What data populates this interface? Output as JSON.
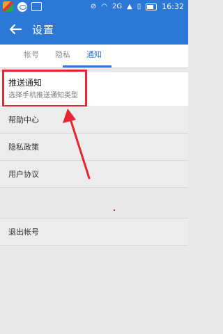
{
  "status": {
    "time": "16:32",
    "network": "2G",
    "icons": [
      "app-launcher-icon",
      "messenger-icon",
      "image-icon",
      "no-signal-icon",
      "wifi-icon",
      "signal-icon",
      "vibrate-icon",
      "battery-icon"
    ]
  },
  "header": {
    "title": "设置",
    "back_icon": "back-arrow-icon"
  },
  "tabs": [
    {
      "label": "帐号",
      "active": false
    },
    {
      "label": "隐私",
      "active": false
    },
    {
      "label": "通知",
      "active": true
    }
  ],
  "notification": {
    "title": "推送通知",
    "subtitle": "选择手机推送通知类型"
  },
  "menu": [
    {
      "label": "帮助中心"
    },
    {
      "label": "隐私政策"
    },
    {
      "label": "用户协议"
    }
  ],
  "logout": {
    "label": "退出帐号"
  },
  "colors": {
    "accent": "#2b78d6",
    "annotation": "#e3262f"
  }
}
